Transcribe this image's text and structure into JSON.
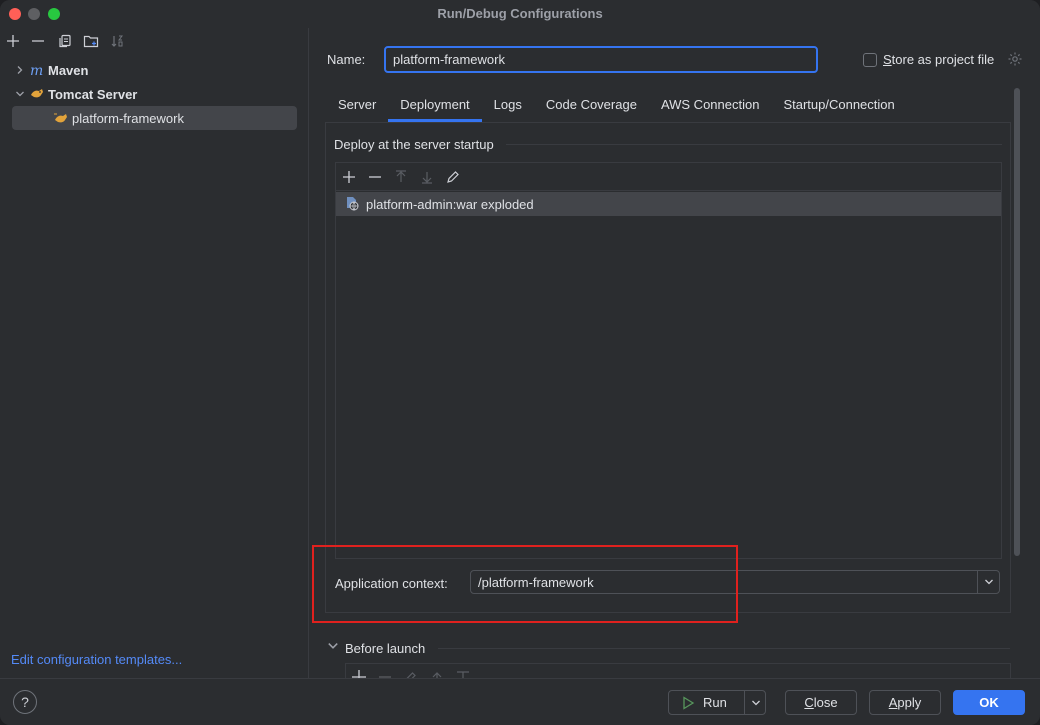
{
  "window": {
    "title": "Run/Debug Configurations"
  },
  "left_panel": {
    "toolbar": [
      {
        "name": "add-icon"
      },
      {
        "name": "remove-icon"
      },
      {
        "name": "copy-icon"
      },
      {
        "name": "new-folder-icon"
      },
      {
        "name": "sort-icon"
      }
    ],
    "tree": [
      {
        "label": "Maven",
        "icon": "maven-icon",
        "expanded": false
      },
      {
        "label": "Tomcat Server",
        "icon": "tomcat-icon",
        "expanded": true
      },
      {
        "label": "platform-framework",
        "icon": "tomcat-config-icon",
        "selected": true
      }
    ],
    "edit_templates": "Edit configuration templates..."
  },
  "right_panel": {
    "name_label": "Name:",
    "name_value": "platform-framework",
    "store_label_underlined": "S",
    "store_label_rest": "tore as project file",
    "store_checked": false,
    "tabs": [
      {
        "label": "Server",
        "active": false
      },
      {
        "label": "Deployment",
        "active": true
      },
      {
        "label": "Logs",
        "active": false
      },
      {
        "label": "Code Coverage",
        "active": false
      },
      {
        "label": "AWS Connection",
        "active": false
      },
      {
        "label": "Startup/Connection",
        "active": false
      }
    ],
    "deployment": {
      "section_title": "Deploy at the server startup",
      "items": [
        {
          "label": "platform-admin:war exploded",
          "icon": "artifact-war-icon"
        }
      ],
      "context_label": "Application context:",
      "context_value": "/platform-framework"
    },
    "before_launch": "Before launch"
  },
  "buttons": {
    "run": "Run",
    "close_u": "C",
    "close_rest": "lose",
    "apply_u": "A",
    "apply_rest": "pply",
    "ok": "OK",
    "help": "?"
  },
  "colors": {
    "accent": "#3574f0",
    "highlight": "#e0211e",
    "link": "#548af7",
    "run_green": "#57965c"
  }
}
